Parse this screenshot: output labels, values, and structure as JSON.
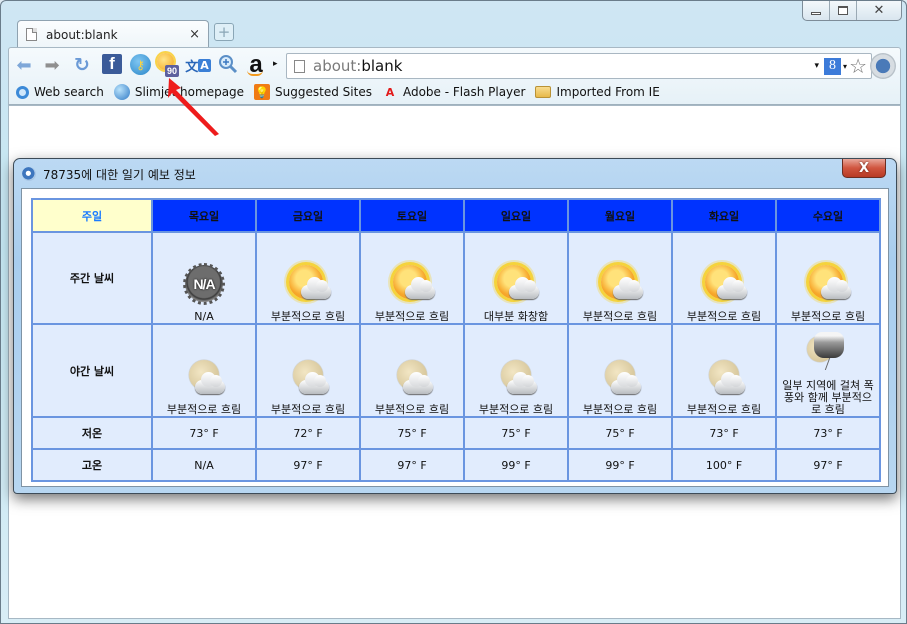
{
  "browser": {
    "tab": {
      "title": "about:blank",
      "close_glyph": "×"
    },
    "new_tab_glyph": "+",
    "window_controls": {
      "minimize": "minimize",
      "maximize": "maximize",
      "close": "✕"
    },
    "toolbar": {
      "back_glyph": "⬅",
      "forward_glyph": "➡",
      "reload_glyph": "↻",
      "extensions": [
        {
          "name": "facebook",
          "glyph": "f"
        },
        {
          "name": "key",
          "glyph": "⚷"
        },
        {
          "name": "weather",
          "badge": "90"
        },
        {
          "name": "translate",
          "glyph": "文",
          "glyph2": "A"
        },
        {
          "name": "zoom",
          "glyph": "🔍"
        },
        {
          "name": "amazon",
          "glyph": "a"
        }
      ],
      "overflow_glyph": "▸",
      "omnibox": {
        "scheme": "about:",
        "rest": "blank",
        "dropdown_glyph": "▾",
        "search_engine_glyph": "8",
        "star_glyph": "☆"
      }
    },
    "bookmarks": [
      {
        "label": "Web search",
        "icon": "search"
      },
      {
        "label": "Slimjet homepage",
        "icon": "globe"
      },
      {
        "label": "Suggested Sites",
        "icon": "bulb"
      },
      {
        "label": "Adobe - Flash Player",
        "icon": "adobe"
      },
      {
        "label": "Imported From IE",
        "icon": "folder"
      }
    ]
  },
  "dialog": {
    "title": "78735에 대한 일기 예보 정보",
    "close_glyph": "X",
    "table": {
      "corner_header": "주일",
      "days": [
        "목요일",
        "금요일",
        "토요일",
        "일요일",
        "월요일",
        "화요일",
        "수요일"
      ],
      "row_labels": {
        "day": "주간 날씨",
        "night": "야간 날씨",
        "low": "저온",
        "high": "고온"
      },
      "day_conditions": [
        {
          "icon": "na",
          "text": "N/A",
          "icon_text": "N/A"
        },
        {
          "icon": "partly-cloudy-day",
          "text": "부분적으로 흐림"
        },
        {
          "icon": "partly-cloudy-day",
          "text": "부분적으로 흐림"
        },
        {
          "icon": "partly-cloudy-day",
          "text": "대부분 화창함"
        },
        {
          "icon": "partly-cloudy-day",
          "text": "부분적으로 흐림"
        },
        {
          "icon": "partly-cloudy-day",
          "text": "부분적으로 흐림"
        },
        {
          "icon": "partly-cloudy-day",
          "text": "부분적으로 흐림"
        }
      ],
      "night_conditions": [
        {
          "icon": "partly-cloudy-night",
          "text": "부분적으로 흐림"
        },
        {
          "icon": "partly-cloudy-night",
          "text": "부분적으로 흐림"
        },
        {
          "icon": "partly-cloudy-night",
          "text": "부분적으로 흐림"
        },
        {
          "icon": "partly-cloudy-night",
          "text": "부분적으로 흐림"
        },
        {
          "icon": "partly-cloudy-night",
          "text": "부분적으로 흐림"
        },
        {
          "icon": "partly-cloudy-night",
          "text": "부분적으로 흐림"
        },
        {
          "icon": "thunderstorm-night",
          "text": "일부 지역에 걸쳐 폭풍와 함께 부분적으로 흐림"
        }
      ],
      "low_temps": [
        "73° F",
        "72° F",
        "75° F",
        "75° F",
        "75° F",
        "73° F",
        "73° F"
      ],
      "high_temps": [
        "N/A",
        "97° F",
        "97° F",
        "99° F",
        "99° F",
        "100° F",
        "97° F"
      ]
    }
  },
  "colors": {
    "header_bg": "#0033ff",
    "header_text": "#33ff33",
    "corner_bg": "#ffffcc",
    "corner_text": "#1b7bff",
    "cell_bg": "#e1ecfd",
    "grid": "#6a95e0",
    "annotation_arrow": "#ee1c1c"
  }
}
